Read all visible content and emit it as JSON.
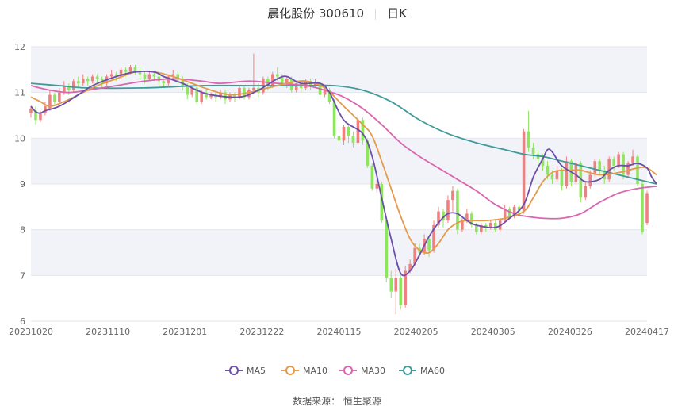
{
  "header": {
    "stock_name": "晨化股份 300610",
    "period": "日K"
  },
  "footer": {
    "source_text": "数据来源：  恒生聚源"
  },
  "colors": {
    "up": "#f08080",
    "down": "#8ee65e",
    "ma5": "#6b4fa8",
    "ma10": "#e39a4b",
    "ma30": "#d866b0",
    "ma60": "#3f9a98",
    "band": "#f2f3f8"
  },
  "chart_data": {
    "type": "candlestick",
    "x_ticks": [
      "20231020",
      "20231110",
      "20231201",
      "20231222",
      "20240115",
      "20240205",
      "20240305",
      "20240326",
      "20240417"
    ],
    "ylim": [
      6,
      12
    ],
    "y_ticks": [
      6,
      7,
      8,
      9,
      10,
      11,
      12
    ],
    "legend": [
      "MA5",
      "MA10",
      "MA30",
      "MA60"
    ],
    "candles": [
      [
        10.55,
        10.65,
        10.45,
        10.7
      ],
      [
        10.6,
        10.4,
        10.3,
        10.7
      ],
      [
        10.4,
        10.55,
        10.35,
        10.6
      ],
      [
        10.55,
        10.7,
        10.5,
        10.8
      ],
      [
        10.65,
        10.95,
        10.6,
        11.05
      ],
      [
        10.95,
        10.8,
        10.7,
        11.0
      ],
      [
        10.8,
        11.0,
        10.75,
        11.1
      ],
      [
        11.0,
        11.15,
        10.95,
        11.25
      ],
      [
        11.15,
        11.05,
        10.95,
        11.2
      ],
      [
        11.05,
        11.25,
        11.0,
        11.3
      ],
      [
        11.25,
        11.2,
        11.1,
        11.35
      ],
      [
        11.2,
        11.3,
        11.15,
        11.4
      ],
      [
        11.3,
        11.25,
        11.15,
        11.35
      ],
      [
        11.25,
        11.35,
        11.2,
        11.4
      ],
      [
        11.35,
        11.3,
        11.2,
        11.4
      ],
      [
        11.3,
        11.2,
        11.1,
        11.35
      ],
      [
        11.2,
        11.35,
        11.15,
        11.4
      ],
      [
        11.35,
        11.4,
        11.3,
        11.5
      ],
      [
        11.4,
        11.35,
        11.25,
        11.45
      ],
      [
        11.35,
        11.5,
        11.3,
        11.55
      ],
      [
        11.5,
        11.45,
        11.35,
        11.55
      ],
      [
        11.45,
        11.55,
        11.4,
        11.6
      ],
      [
        11.55,
        11.45,
        11.4,
        11.6
      ],
      [
        11.45,
        11.4,
        11.3,
        11.55
      ],
      [
        11.4,
        11.3,
        11.2,
        11.45
      ],
      [
        11.3,
        11.4,
        11.25,
        11.45
      ],
      [
        11.4,
        11.35,
        11.25,
        11.45
      ],
      [
        11.35,
        11.25,
        11.15,
        11.4
      ],
      [
        11.25,
        11.2,
        11.1,
        11.3
      ],
      [
        11.2,
        11.35,
        11.15,
        11.4
      ],
      [
        11.35,
        11.4,
        11.3,
        11.5
      ],
      [
        11.4,
        11.3,
        11.2,
        11.45
      ],
      [
        11.3,
        11.15,
        11.05,
        11.35
      ],
      [
        11.15,
        10.95,
        10.85,
        11.2
      ],
      [
        10.95,
        11.1,
        10.9,
        11.15
      ],
      [
        11.1,
        10.8,
        10.75,
        11.15
      ],
      [
        10.8,
        11.0,
        10.75,
        11.05
      ],
      [
        11.0,
        10.9,
        10.85,
        11.05
      ],
      [
        10.9,
        10.95,
        10.85,
        11.0
      ],
      [
        10.95,
        10.9,
        10.8,
        11.0
      ],
      [
        10.9,
        11.0,
        10.85,
        11.05
      ],
      [
        11.0,
        10.85,
        10.75,
        11.05
      ],
      [
        10.85,
        10.95,
        10.8,
        11.0
      ],
      [
        10.95,
        10.9,
        10.8,
        11.0
      ],
      [
        10.9,
        11.1,
        10.85,
        11.15
      ],
      [
        11.1,
        10.9,
        10.85,
        11.15
      ],
      [
        10.9,
        11.05,
        10.85,
        11.1
      ],
      [
        11.05,
        11.1,
        11.0,
        11.85
      ],
      [
        11.1,
        11.0,
        10.9,
        11.2
      ],
      [
        11.0,
        11.3,
        10.95,
        11.35
      ],
      [
        11.3,
        11.15,
        11.05,
        11.35
      ],
      [
        11.15,
        11.4,
        11.1,
        11.45
      ],
      [
        11.4,
        11.35,
        11.25,
        11.55
      ],
      [
        11.35,
        11.2,
        11.15,
        11.4
      ],
      [
        11.2,
        11.3,
        11.1,
        11.35
      ],
      [
        11.3,
        11.05,
        11.0,
        11.35
      ],
      [
        11.05,
        11.2,
        11.0,
        11.25
      ],
      [
        11.2,
        11.1,
        11.0,
        11.25
      ],
      [
        11.1,
        11.25,
        11.05,
        11.3
      ],
      [
        11.25,
        11.15,
        11.05,
        11.3
      ],
      [
        11.15,
        11.2,
        11.1,
        11.3
      ],
      [
        11.2,
        10.95,
        10.9,
        11.25
      ],
      [
        10.95,
        11.05,
        10.9,
        11.1
      ],
      [
        11.05,
        10.8,
        10.75,
        11.1
      ],
      [
        10.8,
        10.05,
        10.0,
        10.85
      ],
      [
        10.05,
        9.95,
        9.8,
        10.2
      ],
      [
        9.95,
        10.25,
        9.85,
        10.3
      ],
      [
        10.25,
        10.05,
        9.9,
        10.3
      ],
      [
        10.05,
        9.9,
        9.8,
        10.15
      ],
      [
        9.9,
        10.4,
        9.85,
        10.5
      ],
      [
        10.4,
        9.95,
        9.85,
        10.45
      ],
      [
        9.95,
        9.4,
        9.35,
        10.0
      ],
      [
        9.4,
        8.9,
        8.85,
        9.45
      ],
      [
        8.9,
        9.0,
        8.8,
        9.1
      ],
      [
        9.0,
        8.2,
        8.15,
        9.05
      ],
      [
        8.2,
        6.95,
        6.85,
        8.25
      ],
      [
        6.95,
        6.65,
        6.5,
        7.1
      ],
      [
        6.65,
        6.95,
        6.15,
        7.15
      ],
      [
        6.95,
        6.35,
        6.25,
        7.05
      ],
      [
        6.35,
        7.1,
        6.3,
        7.2
      ],
      [
        7.1,
        7.25,
        7.05,
        7.35
      ],
      [
        7.25,
        7.6,
        7.2,
        7.7
      ],
      [
        7.6,
        7.5,
        7.4,
        7.7
      ],
      [
        7.5,
        7.8,
        7.45,
        7.9
      ],
      [
        7.8,
        7.55,
        7.4,
        7.85
      ],
      [
        7.55,
        8.1,
        7.5,
        8.2
      ],
      [
        8.1,
        8.4,
        8.05,
        8.5
      ],
      [
        8.4,
        8.2,
        8.05,
        8.45
      ],
      [
        8.2,
        8.65,
        8.15,
        8.75
      ],
      [
        8.65,
        8.85,
        8.4,
        8.95
      ],
      [
        8.85,
        8.0,
        7.9,
        8.9
      ],
      [
        8.0,
        8.2,
        7.95,
        8.25
      ],
      [
        8.2,
        8.35,
        8.15,
        8.45
      ],
      [
        8.35,
        8.1,
        8.05,
        8.4
      ],
      [
        8.1,
        7.95,
        7.9,
        8.15
      ],
      [
        7.95,
        8.1,
        7.9,
        8.15
      ],
      [
        8.1,
        8.05,
        7.95,
        8.15
      ],
      [
        8.05,
        8.15,
        8.0,
        8.2
      ],
      [
        8.15,
        8.0,
        7.95,
        8.2
      ],
      [
        8.0,
        8.2,
        7.95,
        8.25
      ],
      [
        8.2,
        8.45,
        8.15,
        8.55
      ],
      [
        8.45,
        8.3,
        8.25,
        8.5
      ],
      [
        8.3,
        8.5,
        8.25,
        8.55
      ],
      [
        8.5,
        8.4,
        8.3,
        8.55
      ],
      [
        8.4,
        10.15,
        8.35,
        10.2
      ],
      [
        10.15,
        9.8,
        9.7,
        10.6
      ],
      [
        9.8,
        9.65,
        9.55,
        9.9
      ],
      [
        9.65,
        9.55,
        9.45,
        9.75
      ],
      [
        9.55,
        9.4,
        9.3,
        9.65
      ],
      [
        9.4,
        9.2,
        9.1,
        9.5
      ],
      [
        9.2,
        9.1,
        9.0,
        9.3
      ],
      [
        9.1,
        9.3,
        9.05,
        9.4
      ],
      [
        9.3,
        8.95,
        8.85,
        9.35
      ],
      [
        8.95,
        9.5,
        8.9,
        9.6
      ],
      [
        9.5,
        9.05,
        8.95,
        9.55
      ],
      [
        9.05,
        9.45,
        9.0,
        9.5
      ],
      [
        9.45,
        8.7,
        8.6,
        9.5
      ],
      [
        8.7,
        8.95,
        8.65,
        9.05
      ],
      [
        8.95,
        9.2,
        8.9,
        9.3
      ],
      [
        9.2,
        9.5,
        9.15,
        9.55
      ],
      [
        9.5,
        9.3,
        9.2,
        9.55
      ],
      [
        9.3,
        9.1,
        9.0,
        9.4
      ],
      [
        9.1,
        9.55,
        9.05,
        9.6
      ],
      [
        9.55,
        9.4,
        9.3,
        9.6
      ],
      [
        9.4,
        9.65,
        9.35,
        9.7
      ],
      [
        9.65,
        9.2,
        9.1,
        9.7
      ],
      [
        9.2,
        9.45,
        9.15,
        9.5
      ],
      [
        9.45,
        9.6,
        9.4,
        9.75
      ],
      [
        9.6,
        9.0,
        8.95,
        9.65
      ],
      [
        9.0,
        7.95,
        7.9,
        9.05
      ],
      [
        8.15,
        8.8,
        8.1,
        8.85
      ]
    ],
    "ma5": [
      [
        0,
        10.7
      ],
      [
        1,
        10.58
      ],
      [
        2,
        10.55
      ],
      [
        3,
        10.6
      ],
      [
        6,
        10.7
      ],
      [
        10,
        10.95
      ],
      [
        13,
        11.15
      ],
      [
        18,
        11.35
      ],
      [
        22,
        11.45
      ],
      [
        26,
        11.45
      ],
      [
        28,
        11.35
      ],
      [
        32,
        11.2
      ],
      [
        35,
        11.05
      ],
      [
        38,
        10.95
      ],
      [
        44,
        10.9
      ],
      [
        48,
        11.05
      ],
      [
        52,
        11.3
      ],
      [
        54,
        11.35
      ],
      [
        57,
        11.2
      ],
      [
        61,
        11.2
      ],
      [
        63,
        11.0
      ],
      [
        66,
        10.4
      ],
      [
        70,
        10.1
      ],
      [
        72,
        9.6
      ],
      [
        74,
        8.7
      ],
      [
        76,
        7.8
      ],
      [
        78,
        7.05
      ],
      [
        80,
        7.1
      ],
      [
        82,
        7.45
      ],
      [
        84,
        7.85
      ],
      [
        86,
        8.15
      ],
      [
        88,
        8.35
      ],
      [
        90,
        8.35
      ],
      [
        92,
        8.2
      ],
      [
        94,
        8.1
      ],
      [
        98,
        8.05
      ],
      [
        101,
        8.25
      ],
      [
        104,
        8.55
      ],
      [
        106,
        9.15
      ],
      [
        108,
        9.55
      ],
      [
        109,
        9.75
      ],
      [
        110,
        9.7
      ],
      [
        112,
        9.4
      ],
      [
        115,
        9.2
      ],
      [
        117,
        9.05
      ],
      [
        120,
        9.1
      ],
      [
        122,
        9.3
      ],
      [
        124,
        9.4
      ],
      [
        126,
        9.4
      ],
      [
        128,
        9.45
      ],
      [
        130,
        9.35
      ],
      [
        131,
        9.15
      ],
      [
        132,
        9.0
      ]
    ],
    "ma10": [
      [
        0,
        10.9
      ],
      [
        2,
        10.8
      ],
      [
        4,
        10.7
      ],
      [
        7,
        10.8
      ],
      [
        10,
        10.95
      ],
      [
        14,
        11.15
      ],
      [
        18,
        11.3
      ],
      [
        22,
        11.45
      ],
      [
        26,
        11.45
      ],
      [
        30,
        11.35
      ],
      [
        34,
        11.2
      ],
      [
        38,
        11.05
      ],
      [
        42,
        10.95
      ],
      [
        46,
        11.0
      ],
      [
        50,
        11.1
      ],
      [
        54,
        11.2
      ],
      [
        58,
        11.25
      ],
      [
        62,
        11.1
      ],
      [
        66,
        10.7
      ],
      [
        70,
        10.3
      ],
      [
        72,
        10.05
      ],
      [
        74,
        9.5
      ],
      [
        76,
        8.9
      ],
      [
        78,
        8.3
      ],
      [
        80,
        7.8
      ],
      [
        82,
        7.55
      ],
      [
        84,
        7.5
      ],
      [
        86,
        7.7
      ],
      [
        88,
        8.0
      ],
      [
        90,
        8.15
      ],
      [
        92,
        8.2
      ],
      [
        96,
        8.2
      ],
      [
        100,
        8.25
      ],
      [
        104,
        8.4
      ],
      [
        106,
        8.7
      ],
      [
        108,
        9.05
      ],
      [
        110,
        9.25
      ],
      [
        112,
        9.3
      ],
      [
        114,
        9.3
      ],
      [
        116,
        9.3
      ],
      [
        120,
        9.2
      ],
      [
        124,
        9.25
      ],
      [
        128,
        9.35
      ],
      [
        130,
        9.35
      ],
      [
        132,
        9.2
      ]
    ],
    "ma30": [
      [
        0,
        11.15
      ],
      [
        4,
        11.05
      ],
      [
        8,
        11.0
      ],
      [
        12,
        11.05
      ],
      [
        18,
        11.15
      ],
      [
        24,
        11.25
      ],
      [
        30,
        11.3
      ],
      [
        36,
        11.25
      ],
      [
        40,
        11.2
      ],
      [
        46,
        11.25
      ],
      [
        52,
        11.2
      ],
      [
        58,
        11.15
      ],
      [
        62,
        11.05
      ],
      [
        66,
        10.9
      ],
      [
        70,
        10.65
      ],
      [
        74,
        10.3
      ],
      [
        78,
        9.9
      ],
      [
        82,
        9.6
      ],
      [
        86,
        9.35
      ],
      [
        90,
        9.1
      ],
      [
        94,
        8.85
      ],
      [
        98,
        8.55
      ],
      [
        102,
        8.35
      ],
      [
        104,
        8.3
      ],
      [
        108,
        8.25
      ],
      [
        112,
        8.25
      ],
      [
        116,
        8.35
      ],
      [
        120,
        8.6
      ],
      [
        124,
        8.8
      ],
      [
        128,
        8.9
      ],
      [
        132,
        8.95
      ]
    ],
    "ma60": [
      [
        0,
        11.2
      ],
      [
        6,
        11.15
      ],
      [
        12,
        11.1
      ],
      [
        24,
        11.1
      ],
      [
        36,
        11.15
      ],
      [
        48,
        11.15
      ],
      [
        58,
        11.15
      ],
      [
        64,
        11.15
      ],
      [
        70,
        11.05
      ],
      [
        76,
        10.8
      ],
      [
        82,
        10.4
      ],
      [
        88,
        10.1
      ],
      [
        94,
        9.9
      ],
      [
        100,
        9.75
      ],
      [
        104,
        9.65
      ],
      [
        108,
        9.6
      ],
      [
        112,
        9.5
      ],
      [
        116,
        9.4
      ],
      [
        120,
        9.3
      ],
      [
        124,
        9.2
      ],
      [
        128,
        9.1
      ],
      [
        132,
        9.0
      ]
    ]
  }
}
